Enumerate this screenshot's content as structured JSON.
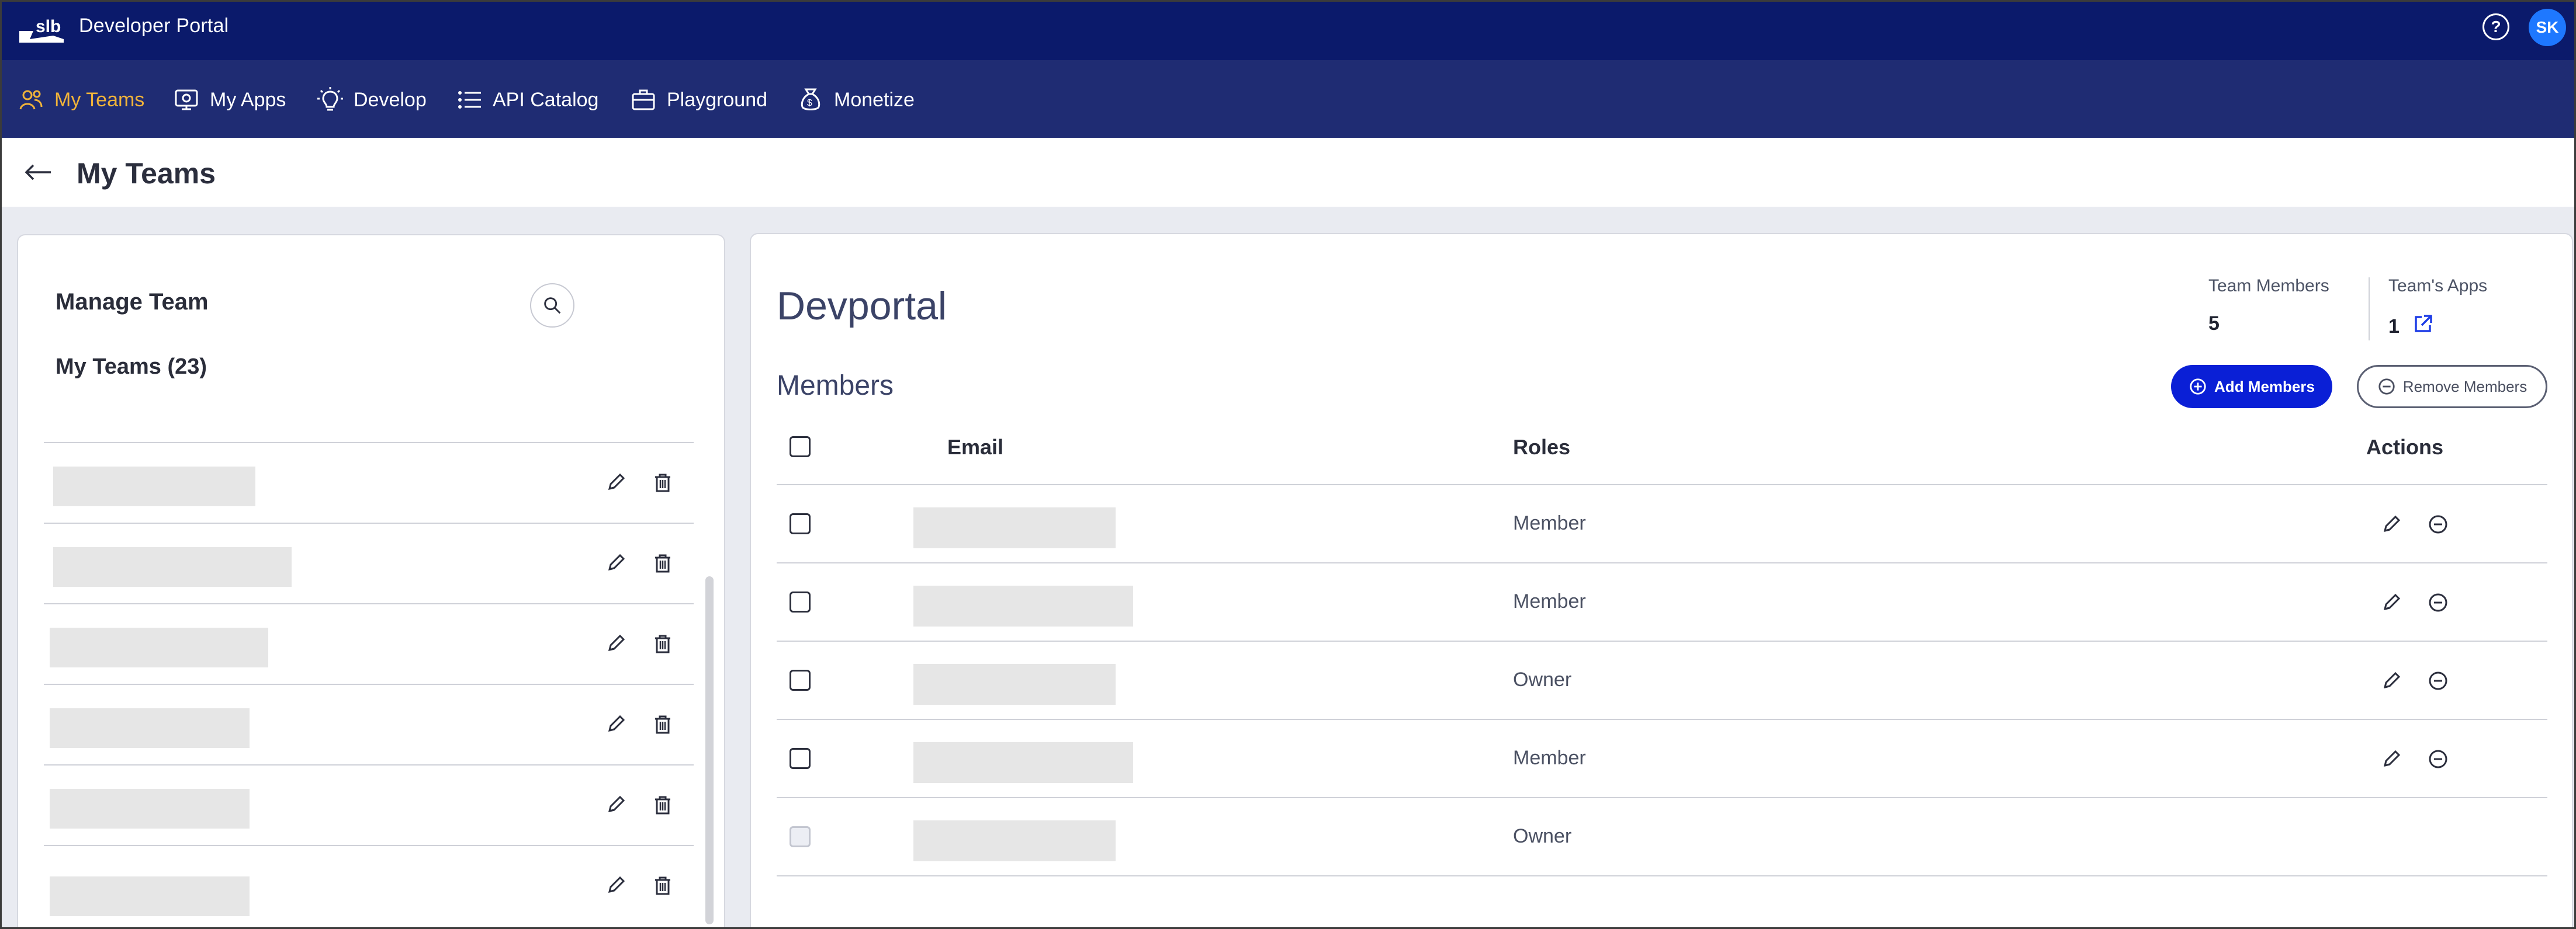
{
  "app": {
    "brand": "slb",
    "title": "Developer Portal",
    "user_initials": "SK"
  },
  "nav": [
    {
      "label": "My Teams",
      "icon": "team-icon",
      "active": true
    },
    {
      "label": "My Apps",
      "icon": "apps-icon",
      "active": false
    },
    {
      "label": "Develop",
      "icon": "bulb-icon",
      "active": false
    },
    {
      "label": "API Catalog",
      "icon": "list-icon",
      "active": false
    },
    {
      "label": "Playground",
      "icon": "toolbox-icon",
      "active": false
    },
    {
      "label": "Monetize",
      "icon": "money-bag-icon",
      "active": false
    }
  ],
  "page": {
    "title": "My Teams"
  },
  "left": {
    "title": "Manage Team",
    "count_label": "My Teams (23)",
    "rows": [
      "",
      "",
      "",
      "",
      "",
      ""
    ]
  },
  "team": {
    "name": "Devportal",
    "members_label": "Team Members",
    "members_count": "5",
    "apps_label": "Team's Apps",
    "apps_count": "1"
  },
  "members": {
    "title": "Members",
    "add_label": "Add Members",
    "remove_label": "Remove Members",
    "headers": {
      "email": "Email",
      "roles": "Roles",
      "actions": "Actions"
    },
    "rows": [
      {
        "email": "",
        "role": "Member",
        "actions": true
      },
      {
        "email": "",
        "role": "Member",
        "actions": true
      },
      {
        "email": "",
        "role": "Owner",
        "actions": true
      },
      {
        "email": "",
        "role": "Member",
        "actions": true
      },
      {
        "email": "",
        "role": "Owner",
        "actions": false
      }
    ]
  },
  "colors": {
    "topbar": "#0b1a6b",
    "navbar": "#1f2c73",
    "accent": "#f0b33a",
    "primary": "#0a1fd6"
  }
}
